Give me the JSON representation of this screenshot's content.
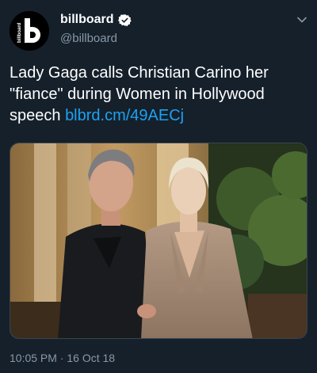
{
  "account": {
    "display_name": "billboard",
    "handle": "@billboard",
    "avatar_logo_text": "billboard",
    "avatar_icon": "billboard-logo-icon",
    "verified_icon": "verified-badge-icon"
  },
  "tweet": {
    "text": "Lady Gaga calls Christian Carino her \"fiance\" during Women in Hollywood speech ",
    "link": "blbrd.cm/49AECj",
    "media_icon": "photo",
    "timestamp": "10:05 PM · 16 Oct 18"
  },
  "colors": {
    "background": "#15202b",
    "secondary_text": "#8899a6",
    "link": "#1da1f2",
    "verified": "#ffffff"
  }
}
